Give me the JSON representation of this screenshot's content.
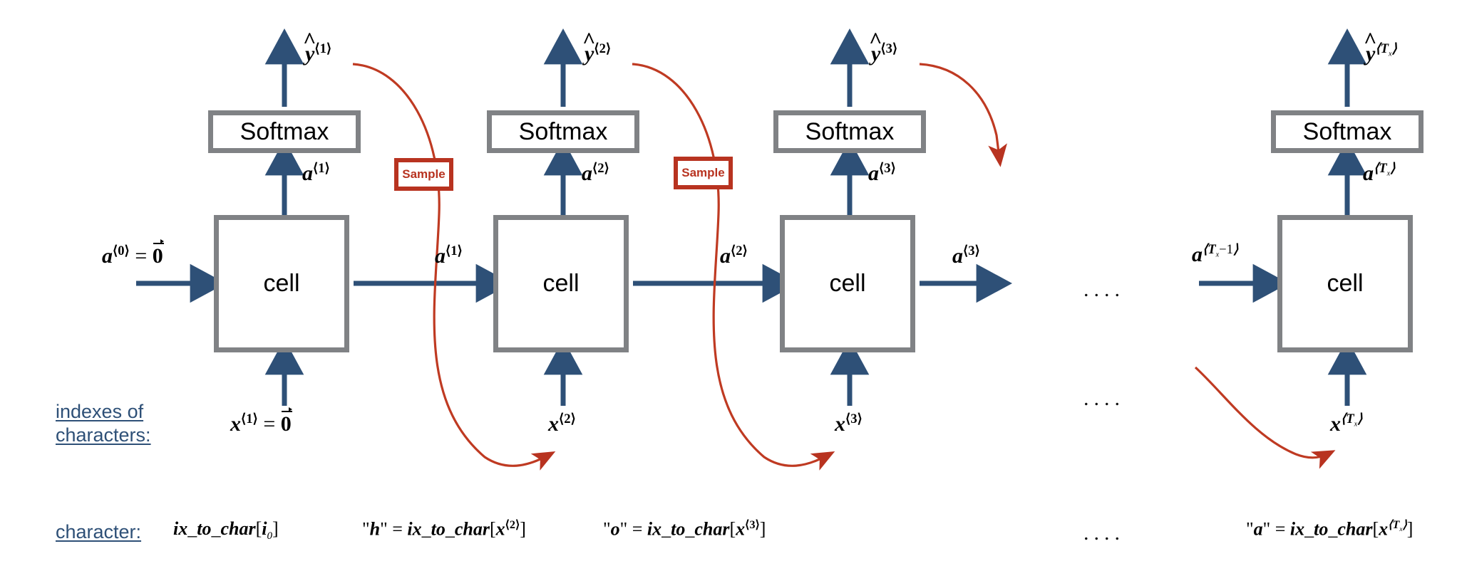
{
  "diagram": {
    "title": "RNN character-level sampling unrolled network",
    "colors": {
      "box_border": "#808285",
      "arrow_blue": "#2e5077",
      "sample_red": "#b83320",
      "label_blue": "#2e5077",
      "background": "#ffffff"
    }
  },
  "row_labels": {
    "indexes_line1": "indexes of",
    "indexes_line2": "characters:",
    "character": "character:"
  },
  "timesteps": [
    {
      "id": "t1",
      "softmax_label": "Softmax",
      "cell_label": "cell",
      "yhat": {
        "base": "y",
        "sup": "⟨1⟩"
      },
      "a_out": {
        "base": "a",
        "sup": "⟨1⟩"
      },
      "a_in": {
        "base": "a",
        "sup": "⟨0⟩",
        "eq": "= 0"
      },
      "a_right": {
        "base": "a",
        "sup": "⟨1⟩"
      },
      "x_in": {
        "base": "x",
        "sup": "⟨1⟩",
        "eq": "= 0"
      },
      "character_formula": "ix_to_char[i0]"
    },
    {
      "id": "t2",
      "softmax_label": "Softmax",
      "cell_label": "cell",
      "yhat": {
        "base": "y",
        "sup": "⟨2⟩"
      },
      "a_out": {
        "base": "a",
        "sup": "⟨2⟩"
      },
      "a_right": {
        "base": "a",
        "sup": "⟨2⟩"
      },
      "x_in": {
        "base": "x",
        "sup": "⟨2⟩"
      },
      "character_formula": "\"h\" = ix_to_char[x⟨2⟩]"
    },
    {
      "id": "t3",
      "softmax_label": "Softmax",
      "cell_label": "cell",
      "yhat": {
        "base": "y",
        "sup": "⟨3⟩"
      },
      "a_out": {
        "base": "a",
        "sup": "⟨3⟩"
      },
      "a_right": {
        "base": "a",
        "sup": "⟨3⟩"
      },
      "x_in": {
        "base": "x",
        "sup": "⟨3⟩"
      },
      "character_formula": "\"o\" = ix_to_char[x⟨3⟩]"
    },
    {
      "id": "tTx",
      "softmax_label": "Softmax",
      "cell_label": "cell",
      "yhat": {
        "base": "y",
        "sup": "⟨Tx⟩"
      },
      "a_out": {
        "base": "a",
        "sup": "⟨Tx⟩"
      },
      "a_in": {
        "base": "a",
        "sup": "⟨Tx-1⟩"
      },
      "x_in": {
        "base": "x",
        "sup": "⟨Tx⟩"
      },
      "character_formula": "\"a\" = ix_to_char[x⟨Tx⟩]"
    }
  ],
  "sample_boxes": [
    {
      "id": "sample-1",
      "label": "Sample"
    },
    {
      "id": "sample-2",
      "label": "Sample"
    }
  ],
  "ellipsis": {
    "middle_row": "....",
    "lower_row": "....",
    "bottom_row": "...."
  }
}
